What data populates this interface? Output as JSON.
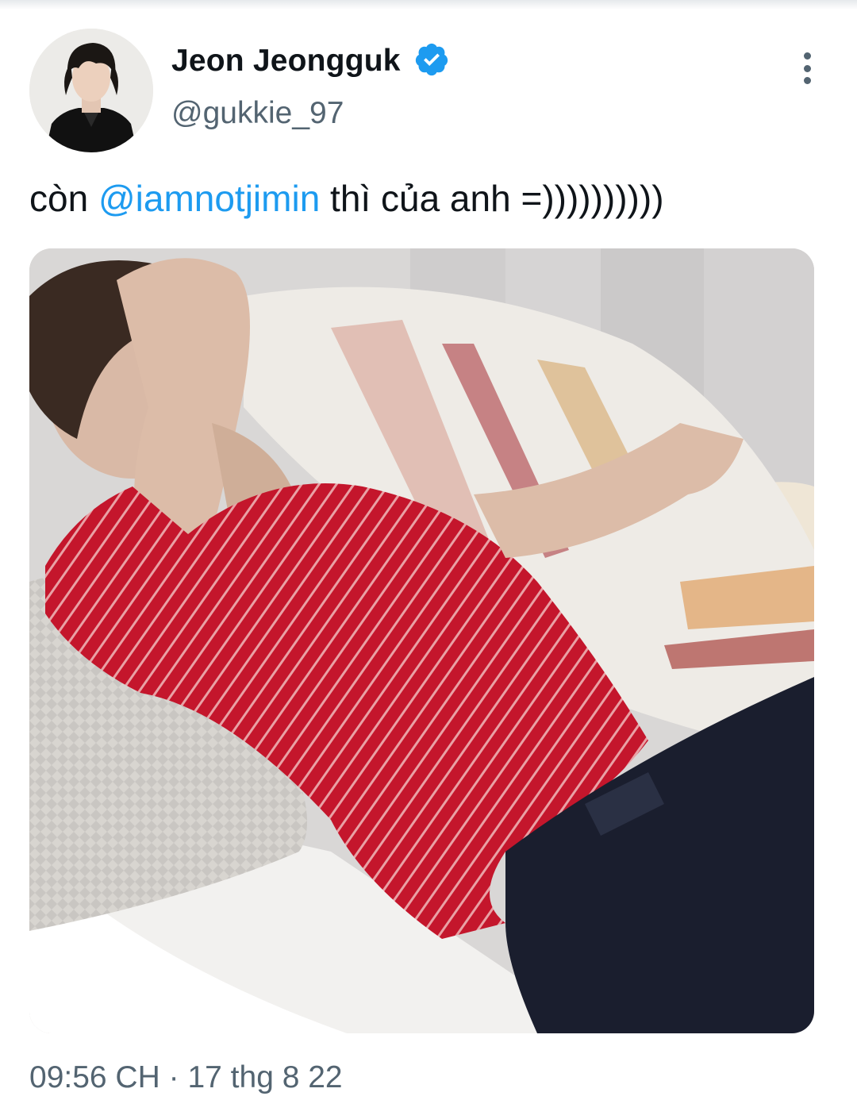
{
  "tweet": {
    "display_name": "Jeon Jeongguk",
    "handle": "@gukkie_97",
    "verified_icon": "verified-badge-icon",
    "text_prefix": "còn ",
    "mention": "@iamnotjimin",
    "text_suffix": " thì của anh =))))))))))",
    "media_icon": "photo",
    "time": "09:56 CH",
    "separator": "·",
    "date": "17 thg 8 22"
  },
  "colors": {
    "text": "#0f1419",
    "secondary": "#536471",
    "accent": "#1d9bf0"
  }
}
